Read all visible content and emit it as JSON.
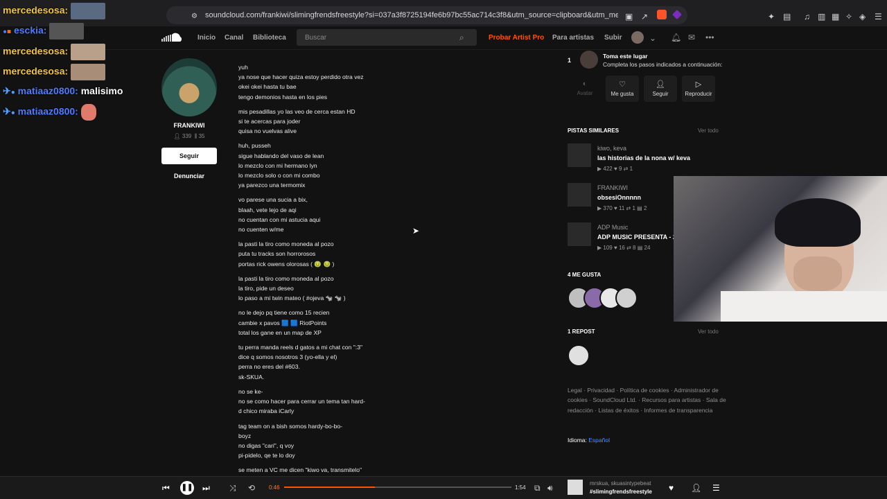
{
  "browser": {
    "url": "soundcloud.com/frankiwi/slimingfrendsfreestyle?si=037a3f8725194fe6b97bc55ac714c3f8&utm_source=clipboard&utm_medium=text&utm_ca..."
  },
  "nav": {
    "home": "Inicio",
    "feed": "Canal",
    "library": "Biblioteca",
    "search_placeholder": "Buscar",
    "pro": "Probar Artist Pro",
    "for_artists": "Para artistas",
    "upload": "Subir"
  },
  "artist": {
    "name": "FRANKIWI",
    "followers": "339",
    "tracks": "35",
    "follow_label": "Seguir",
    "report_label": "Denunciar"
  },
  "lyrics": [
    [
      "yuh",
      "ya nose que hacer quiza estoy perdido otra vez",
      "okei okei hasta tu bae",
      "tengo demonios hasta en los pies"
    ],
    [
      "mis pesadillas yo las veo de cerca estan HD",
      "si te acercas para joder",
      "quisa no vuelvas alive"
    ],
    [
      "huh, pusseh",
      "sigue hablando del vaso de lean",
      "lo mezclo con mi hermano lyn",
      "lo mezclo solo o con mi combo",
      "ya parezco una termomix"
    ],
    [
      "vo parese una sucia a bix,",
      "blaah, vete lejo de aqi",
      "no cuentan con mi astucia aqui",
      "no cuenten w/me"
    ],
    [
      "la pasti la tiro como moneda al pozo",
      "puta tu tracks son horrorosos",
      "portas rick owens olorosas ( 🤢 🤢 )"
    ],
    [
      "la pasti la tiro como moneda al pozo",
      "la tiro, pide un deseo",
      "lo paso a mi twin mateo ( #ojeva 🐄 🐄 )"
    ],
    [
      "no le dejo pq tiene como 15 recien",
      "cambie x pavos 🟦 🟦 RiotPoints",
      "total los gane en un map de XP"
    ],
    [
      "tu perra manda reels d gatos a mi chat con \":3\"",
      "dice q somos nosotros 3 (yo-ella y el)",
      "perra no eres del #603.",
      "sk-SKUA."
    ],
    [
      "no se ke-",
      "no se como hacer para cerrar un tema tan hard-",
      "d chico miraba iCarly"
    ],
    [
      "tag team on a bish somos hardy-bo-bo-",
      "boyz",
      "no digas \"cari\", q voy",
      "pi-pidelo, qe te lo doy"
    ],
    [
      "se meten a VC me dicen \"kiwo va, transmitelo\""
    ]
  ],
  "steps": {
    "number": "1",
    "title": "Toma este lugar",
    "subtitle": "Completa los pasos indicados a continuación:",
    "avatar_label": "Avatar",
    "like_label": "Me gusta",
    "follow_label": "Seguir",
    "play_label": "Reproducir"
  },
  "similar": {
    "heading": "PISTAS SIMILARES",
    "see_all": "Ver todo",
    "tracks": [
      {
        "artist": "kiwo, keva",
        "title": "las historias de la nona w/ keva",
        "plays": "422",
        "likes": "9",
        "reposts": "1",
        "comments": ""
      },
      {
        "artist": "FRANKIWI",
        "title": "obsesiOnnnnn",
        "plays": "370",
        "likes": "11",
        "reposts": "1",
        "comments": "2"
      },
      {
        "artist": "ADP Music",
        "title": "ADP MUSIC PRESENTA - 2",
        "plays": "109",
        "likes": "16",
        "reposts": "8",
        "comments": "24"
      }
    ]
  },
  "likes": {
    "heading": "4 ME GUSTA"
  },
  "reposts": {
    "heading": "1 REPOST",
    "see_all": "Ver todo"
  },
  "footer": {
    "links": "Legal · Privacidad · Política de cookies · Administrador de cookies · SoundCloud Ltd. · Recursos para artistas · Sala de redacción · Listas de éxitos · Informes de transparencia",
    "language_label": "Idioma:",
    "language": "Español"
  },
  "chat": [
    {
      "user": "mercedesosa:",
      "text": "",
      "color": "#f0c33c"
    },
    {
      "user": "esckia:",
      "text": "",
      "color": "#4d7cff"
    },
    {
      "user": "mercedesosa:",
      "text": "",
      "color": "#f0c33c"
    },
    {
      "user": "mercedesosa:",
      "text": "",
      "color": "#f0c33c"
    },
    {
      "user": "matiaaz0800:",
      "text": " malisimo",
      "color": "#4d7cff"
    },
    {
      "user": "matiaaz0800:",
      "text": "",
      "color": "#4d7cff"
    }
  ],
  "player": {
    "elapsed": "0:46",
    "duration": "1:54",
    "progress": 0.4,
    "now_artist": "mrskua, skuasintypebeat",
    "now_title": "#slimingfrendsfreestyle"
  },
  "colors": {
    "accent": "#ff5500",
    "link": "#4d8fff",
    "background": "#121212"
  }
}
